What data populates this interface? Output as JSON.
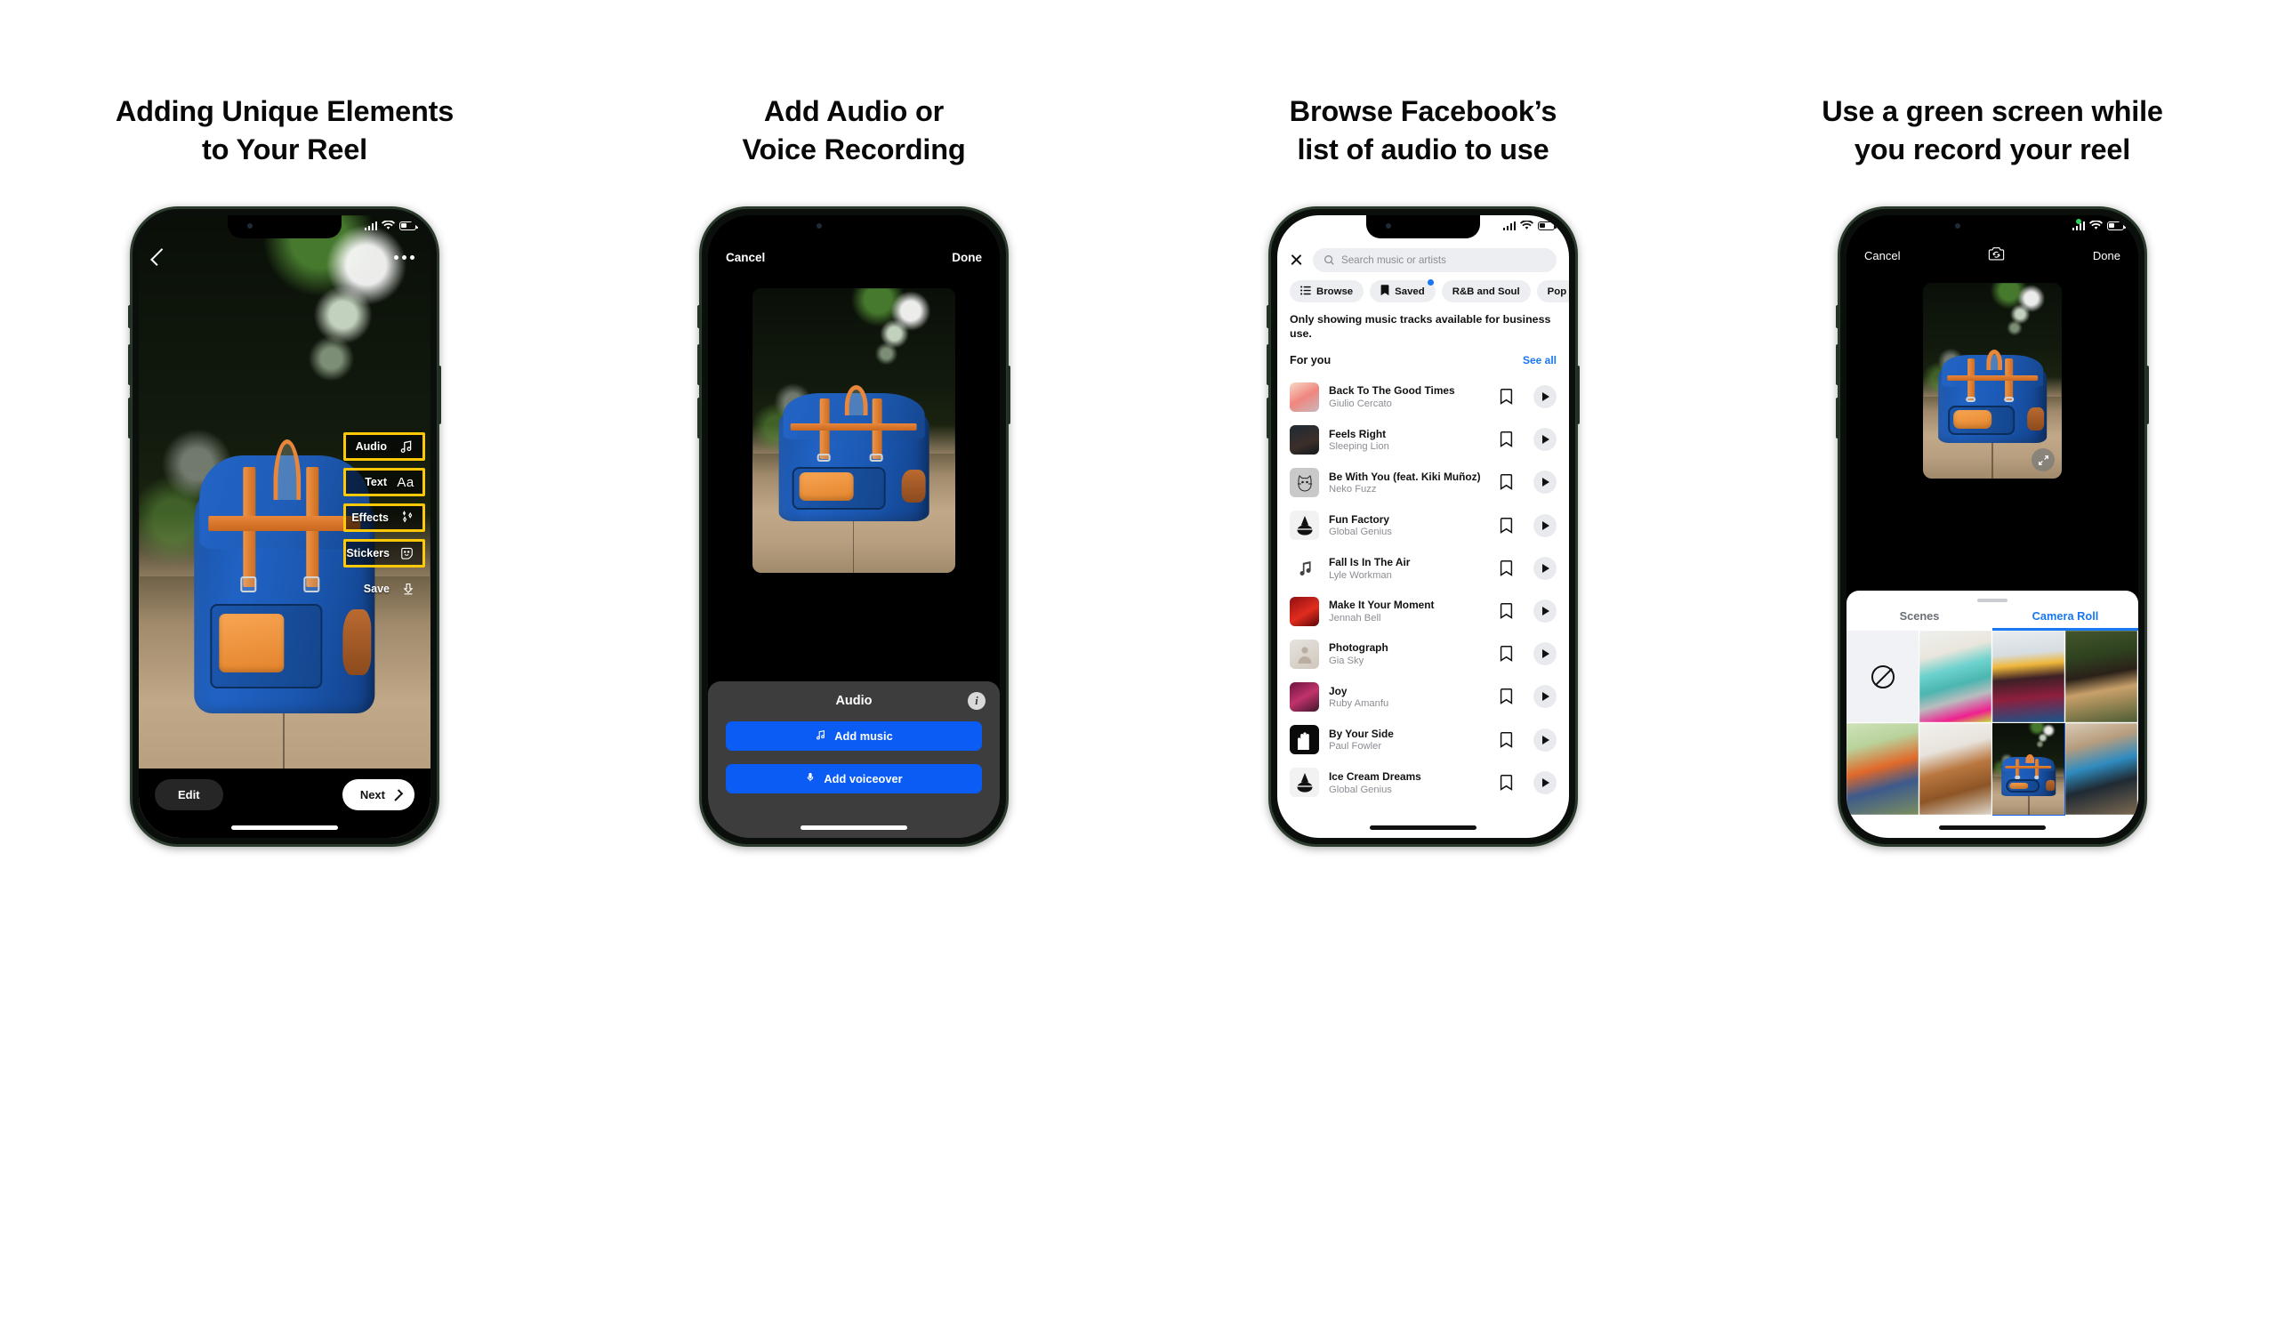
{
  "panels": [
    {
      "heading_line1": "Adding Unique Elements",
      "heading_line2": "to Your Reel",
      "screen": {
        "back_icon": "chevron-left-icon",
        "more_icon": "more-options-icon",
        "tools": [
          {
            "label": "Audio",
            "icon": "music-note-icon",
            "highlighted": true
          },
          {
            "label": "Text",
            "icon": "text-aa-icon",
            "highlighted": true
          },
          {
            "label": "Effects",
            "icon": "sparkles-icon",
            "highlighted": true
          },
          {
            "label": "Stickers",
            "icon": "sticker-face-icon",
            "highlighted": true
          },
          {
            "label": "Save",
            "icon": "download-icon",
            "highlighted": false
          }
        ],
        "edit_label": "Edit",
        "next_label": "Next",
        "highlight_color": "#FFC907"
      }
    },
    {
      "heading_line1": "Add Audio or",
      "heading_line2": "Voice Recording",
      "screen": {
        "cancel_label": "Cancel",
        "done_label": "Done",
        "sheet_title": "Audio",
        "info_label": "i",
        "buttons": [
          {
            "label": "Add music",
            "icon": "music-note-icon"
          },
          {
            "label": "Add voiceover",
            "icon": "microphone-icon"
          }
        ],
        "button_color": "#0B5CF5"
      }
    },
    {
      "heading_line1": "Browse Facebook’s",
      "heading_line2": "list of audio to use",
      "screen": {
        "close_icon": "close-icon",
        "search_placeholder": "Search music or artists",
        "chips": [
          {
            "label": "Browse",
            "icon": "list-icon",
            "badge": false
          },
          {
            "label": "Saved",
            "icon": "bookmark-icon",
            "badge": true
          },
          {
            "label": "R&B and Soul",
            "icon": null,
            "badge": false
          },
          {
            "label": "Pop",
            "icon": null,
            "badge": false
          }
        ],
        "notice": "Only showing music tracks available for business use.",
        "section_title": "For you",
        "see_all_label": "See all",
        "link_color": "#1877F2",
        "tracks": [
          {
            "title": "Back To The Good Times",
            "artist": "Giulio Cercato",
            "art": "pinkfade"
          },
          {
            "title": "Feels Right",
            "artist": "Sleeping Lion",
            "art": "darkduo"
          },
          {
            "title": "Be With You (feat. Kiki Muñoz)",
            "artist": "Neko Fuzz",
            "art": "cat"
          },
          {
            "title": "Fun Factory",
            "artist": "Global Genius",
            "art": "globe"
          },
          {
            "title": "Fall Is In The Air",
            "artist": "Lyle Workman",
            "art": "note"
          },
          {
            "title": "Make It Your Moment",
            "artist": "Jennah Bell",
            "art": "red"
          },
          {
            "title": "Photograph",
            "artist": "Gia Sky",
            "art": "pale"
          },
          {
            "title": "Joy",
            "artist": "Ruby Amanfu",
            "art": "magenta"
          },
          {
            "title": "By Your Side",
            "artist": "Paul Fowler",
            "art": "hands"
          },
          {
            "title": "Ice Cream Dreams",
            "artist": "Global Genius",
            "art": "globe"
          }
        ]
      }
    },
    {
      "heading_line1": "Use a green screen while",
      "heading_line2": "you record your reel",
      "screen": {
        "cancel_label": "Cancel",
        "done_label": "Done",
        "flip_icon": "camera-flip-icon",
        "expand_icon": "expand-icon",
        "tabs": [
          {
            "label": "Scenes",
            "active": false
          },
          {
            "label": "Camera Roll",
            "active": true
          }
        ],
        "accent_color": "#1877F2",
        "cells": [
          {
            "kind": "none",
            "name": "no-background-option",
            "selected": false
          },
          {
            "kind": "photo",
            "name": "photo-friends",
            "selected": false
          },
          {
            "kind": "photo",
            "name": "photo-station",
            "selected": false
          },
          {
            "kind": "photo",
            "name": "photo-hiker",
            "selected": false
          },
          {
            "kind": "photo",
            "name": "photo-tent",
            "selected": false
          },
          {
            "kind": "photo",
            "name": "photo-leather-bag",
            "selected": false
          },
          {
            "kind": "photo",
            "name": "photo-blue-backpack",
            "selected": true
          },
          {
            "kind": "photo",
            "name": "photo-hiking-pack",
            "selected": false
          }
        ]
      }
    }
  ]
}
